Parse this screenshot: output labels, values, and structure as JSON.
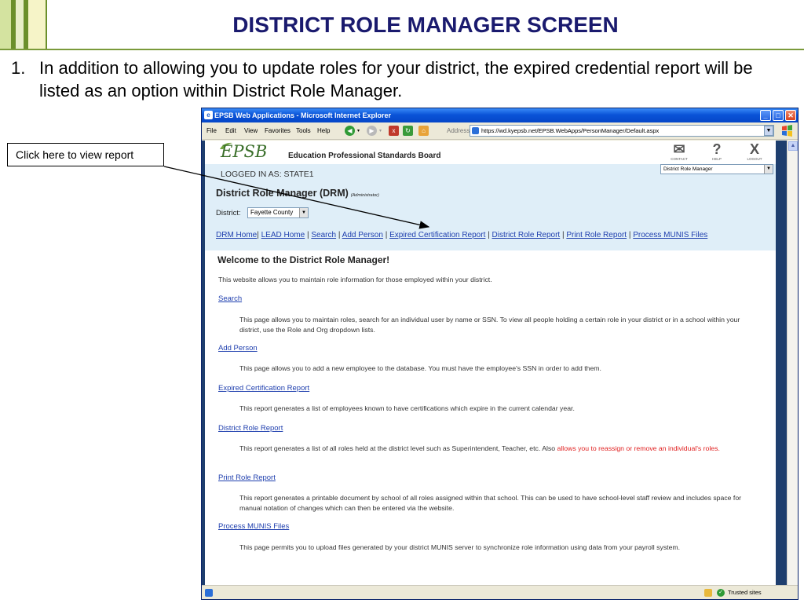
{
  "slide": {
    "title": "DISTRICT ROLE MANAGER SCREEN",
    "bullet_number": "1.",
    "bullet_text": "In addition to allowing you to update roles for your district, the expired credential report will be listed as an option within District Role Manager.",
    "callout": "Click here to view report"
  },
  "browser": {
    "window_title": "EPSB Web Applications - Microsoft Internet Explorer",
    "menu": [
      "File",
      "Edit",
      "View",
      "Favorites",
      "Tools",
      "Help"
    ],
    "address_label": "Address",
    "url": "https://wd.kyepsb.net/EPSB.WebApps/PersonManager/Default.aspx",
    "status_zone": "Trusted sites"
  },
  "header": {
    "logo": "EPSB",
    "board_name": "Education Professional Standards Board",
    "icons": [
      {
        "name": "contact",
        "caption": "CONTACT"
      },
      {
        "name": "help",
        "caption": "HELP"
      },
      {
        "name": "logout",
        "caption": "LOGOUT"
      }
    ],
    "app_select": "District Role Manager"
  },
  "session": {
    "logged_in": "LOGGED IN AS: STATE1"
  },
  "drm": {
    "title": "District Role Manager (DRM)",
    "subtitle": "(Administrator)",
    "district_label": "District:",
    "district_value": "Fayette County",
    "nav": [
      "DRM Home",
      "LEAD Home",
      "Search",
      "Add Person",
      "Expired Certification Report",
      "District Role Report",
      "Print Role Report",
      "Process MUNIS Files"
    ]
  },
  "content": {
    "welcome": "Welcome to the District Role Manager!",
    "intro": "This website allows you to maintain role information for those employed within your district.",
    "sections": [
      {
        "link": "Search",
        "desc": "This page allows you to maintain roles, search for an individual user by name or SSN. To view all people holding a certain role in your district or in a school within your district, use the Role and Org dropdown lists."
      },
      {
        "link": "Add Person",
        "desc": "This page allows you to add a new employee to the database. You must have the employee's SSN in order to add them."
      },
      {
        "link": "Expired Certification Report",
        "desc": "This report generates a list of employees known to have certifications which expire in the current calendar year."
      },
      {
        "link": "District Role Report",
        "desc": "This report generates a list of all roles held at the district level such as Superintendent, Teacher, etc. Also ",
        "desc_highlight": "allows you to reassign or remove an individual's roles."
      },
      {
        "link": "Print Role Report",
        "desc": "This report generates a printable document by school of all roles assigned within that school. This can be used to have school-level staff review and includes space for manual notation of changes which can then be entered via the website."
      },
      {
        "link": "Process MUNIS Files",
        "desc": "This page permits you to upload files generated by your district MUNIS server to synchronize role information using data from your payroll system."
      }
    ]
  },
  "colors": {
    "title_text": "#1a1a6e",
    "link": "#1f3fae",
    "highlight": "#e02020",
    "band": "#dfeef8"
  }
}
